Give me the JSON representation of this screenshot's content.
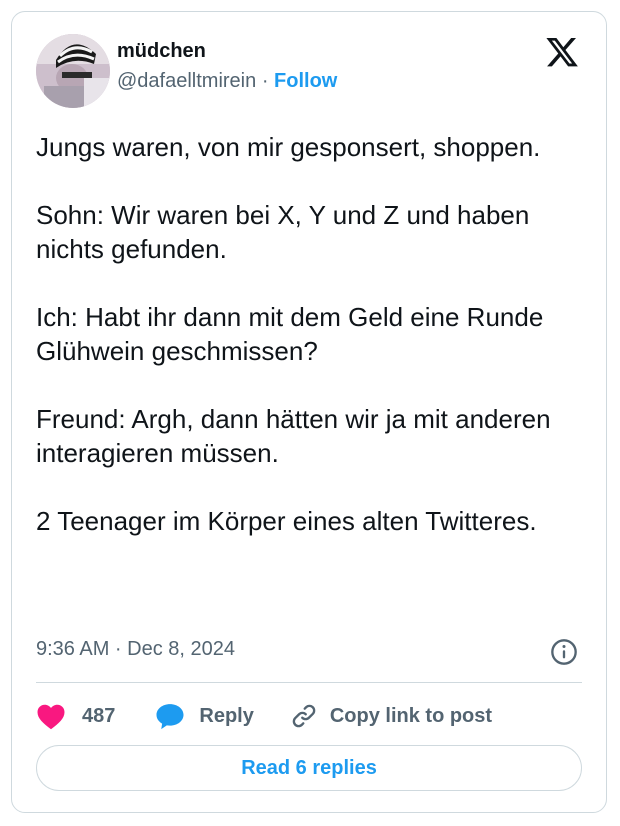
{
  "author": {
    "display_name": "müdchen",
    "handle": "@dafaelltmirein",
    "separator": "·",
    "follow_label": "Follow"
  },
  "post": {
    "paragraphs": [
      "Jungs waren, von mir gesponsert, shoppen.",
      "Sohn: Wir waren bei X, Y und Z und haben nichts gefunden.",
      "Ich: Habt ihr dann mit dem Geld eine Runde Glühwein geschmissen?",
      "Freund: Argh, dann hätten wir ja mit anderen interagieren müssen.",
      "2 Teenager im Körper eines alten Twitteres."
    ],
    "timestamp": "9:36 AM · Dec 8, 2024"
  },
  "actions": {
    "likes_count": "487",
    "reply_label": "Reply",
    "copy_link_label": "Copy link to post"
  },
  "read_replies_label": "Read 6 replies",
  "colors": {
    "accent": "#1d9bf0",
    "like": "#f91880",
    "text": "#0f1419",
    "muted": "#536471",
    "border": "#cfd9de"
  },
  "icons": [
    "x-logo-icon",
    "info-icon",
    "heart-icon",
    "reply-bubble-icon",
    "link-icon"
  ]
}
